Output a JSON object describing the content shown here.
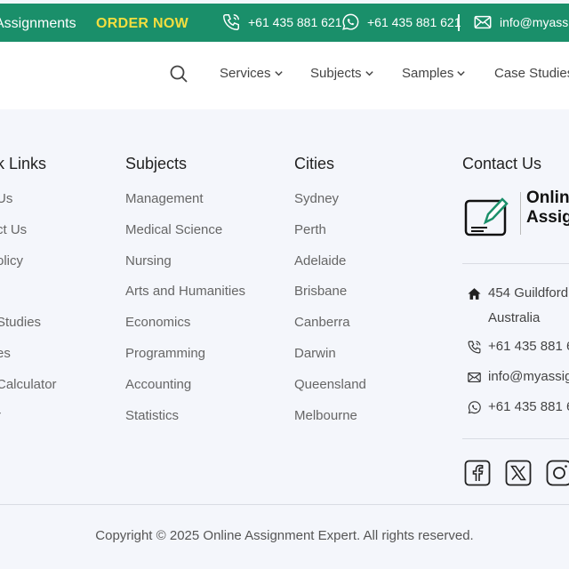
{
  "topbar": {
    "brand_fragment": "Assignments",
    "order_now": "ORDER NOW",
    "phone_1": "+61 435 881 621",
    "whatsapp": "+61 435 881 621",
    "email": "info@myassi",
    "bg_color": "#1a8f6a",
    "accent_color": "#f3de3f"
  },
  "nav": {
    "items": [
      {
        "label": "Services"
      },
      {
        "label": "Subjects"
      },
      {
        "label": "Samples"
      },
      {
        "label": "Case Studies"
      }
    ]
  },
  "footer": {
    "quick_links": {
      "heading": "k Links",
      "items": [
        "Us",
        "ct Us",
        "olicy",
        "",
        "Studies",
        "es",
        "Calculator",
        "r"
      ]
    },
    "subjects": {
      "heading": "Subjects",
      "items": [
        "Management",
        "Medical Science",
        "Nursing",
        "Arts and Humanities",
        "Economics",
        "Programming",
        "Accounting",
        "Statistics"
      ]
    },
    "cities": {
      "heading": "Cities",
      "items": [
        "Sydney",
        "Perth",
        "Adelaide",
        "Brisbane",
        "Canberra",
        "Darwin",
        "Queensland",
        "Melbourne"
      ]
    },
    "contact": {
      "heading": "Contact Us",
      "logo_line1": "Onlin",
      "logo_line2": "Assig",
      "address_line1": "454 Guildford",
      "address_line2": "Australia",
      "phone": "+61 435 881 6",
      "email": "info@myassig",
      "whatsapp": "+61 435 881 6"
    },
    "copyright": "Copyright © 2025 Online Assignment Expert. All rights reserved."
  }
}
